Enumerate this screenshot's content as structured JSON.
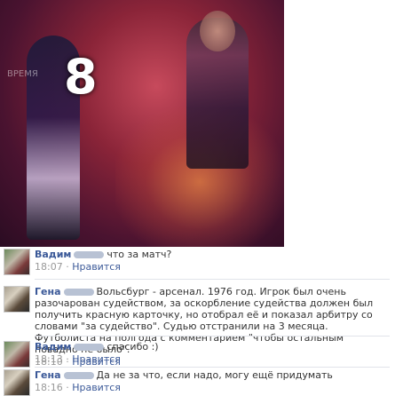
{
  "comments": [
    {
      "author": "Вадим",
      "text": "что за матч?",
      "time": "18:07",
      "like": "Нравится"
    },
    {
      "author": "Гена",
      "text": "Вольсбург - арсенал. 1976 год. Игрок был очень разочарован судейством, за оскорбление судейства должен был получить красную карточку, но отобрал её и показал арбитру со словами \"за судейство\". Судью отстранили на 3 месяца. Футболиста на полгода с комментарием \"чтобы остальным повадно не было\".",
      "time": "18:10",
      "like": "Нравится"
    },
    {
      "author": "Вадим",
      "text": "спасибо :)",
      "time": "18:13",
      "like": "Нравится"
    },
    {
      "author": "Гена",
      "text": "Да не за что, если надо, могу ещё придумать",
      "time": "18:16",
      "like": "Нравится"
    }
  ],
  "photo": {
    "jersey_number": "8",
    "watermark": "ВРЕМЯ"
  },
  "dot": "·"
}
